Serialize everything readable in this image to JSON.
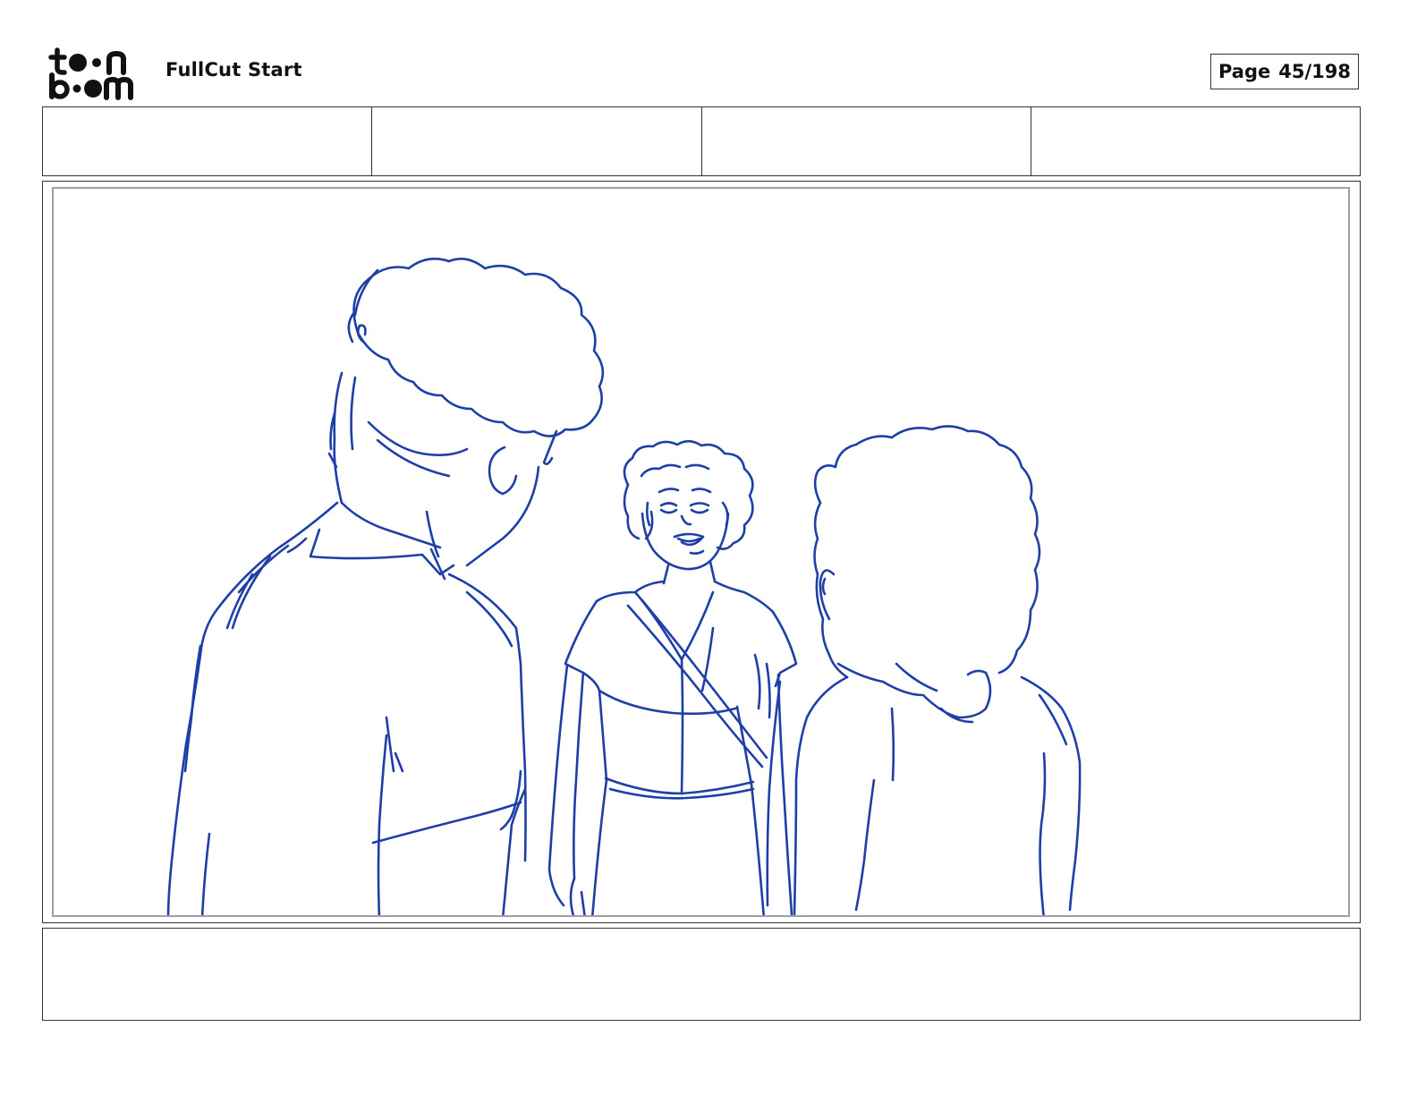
{
  "header": {
    "logo_top": "t●●n",
    "logo_bottom": "b●●m",
    "project_title": "FullCut Start",
    "page_word": "Page",
    "page_value": "45/198"
  },
  "info_fields": [
    "",
    "",
    "",
    ""
  ],
  "panel": {
    "sketch_color": "#1f3fa8"
  },
  "caption": {
    "text": ""
  }
}
